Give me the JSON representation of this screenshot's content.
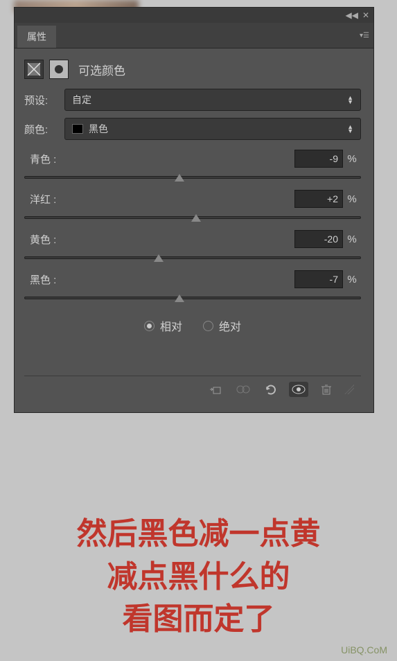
{
  "panel": {
    "tab_label": "属性",
    "adjustment_title": "可选颜色",
    "preset": {
      "label": "预设:",
      "value": "自定"
    },
    "color": {
      "label": "颜色:",
      "value": "黑色",
      "swatch": "#000000"
    },
    "sliders": [
      {
        "label": "青色 :",
        "value": "-9",
        "percent": "%",
        "pos": 46
      },
      {
        "label": "洋红 :",
        "value": "+2",
        "percent": "%",
        "pos": 51
      },
      {
        "label": "黄色 :",
        "value": "-20",
        "percent": "%",
        "pos": 40
      },
      {
        "label": "黑色 :",
        "value": "-7",
        "percent": "%",
        "pos": 46
      }
    ],
    "method": {
      "relative": "相对",
      "absolute": "绝对",
      "selected": "relative"
    }
  },
  "annotation": {
    "line1": "然后黑色减一点黄",
    "line2": "减点黑什么的",
    "line3": "看图而定了"
  },
  "watermark": "UiBQ.CoM"
}
